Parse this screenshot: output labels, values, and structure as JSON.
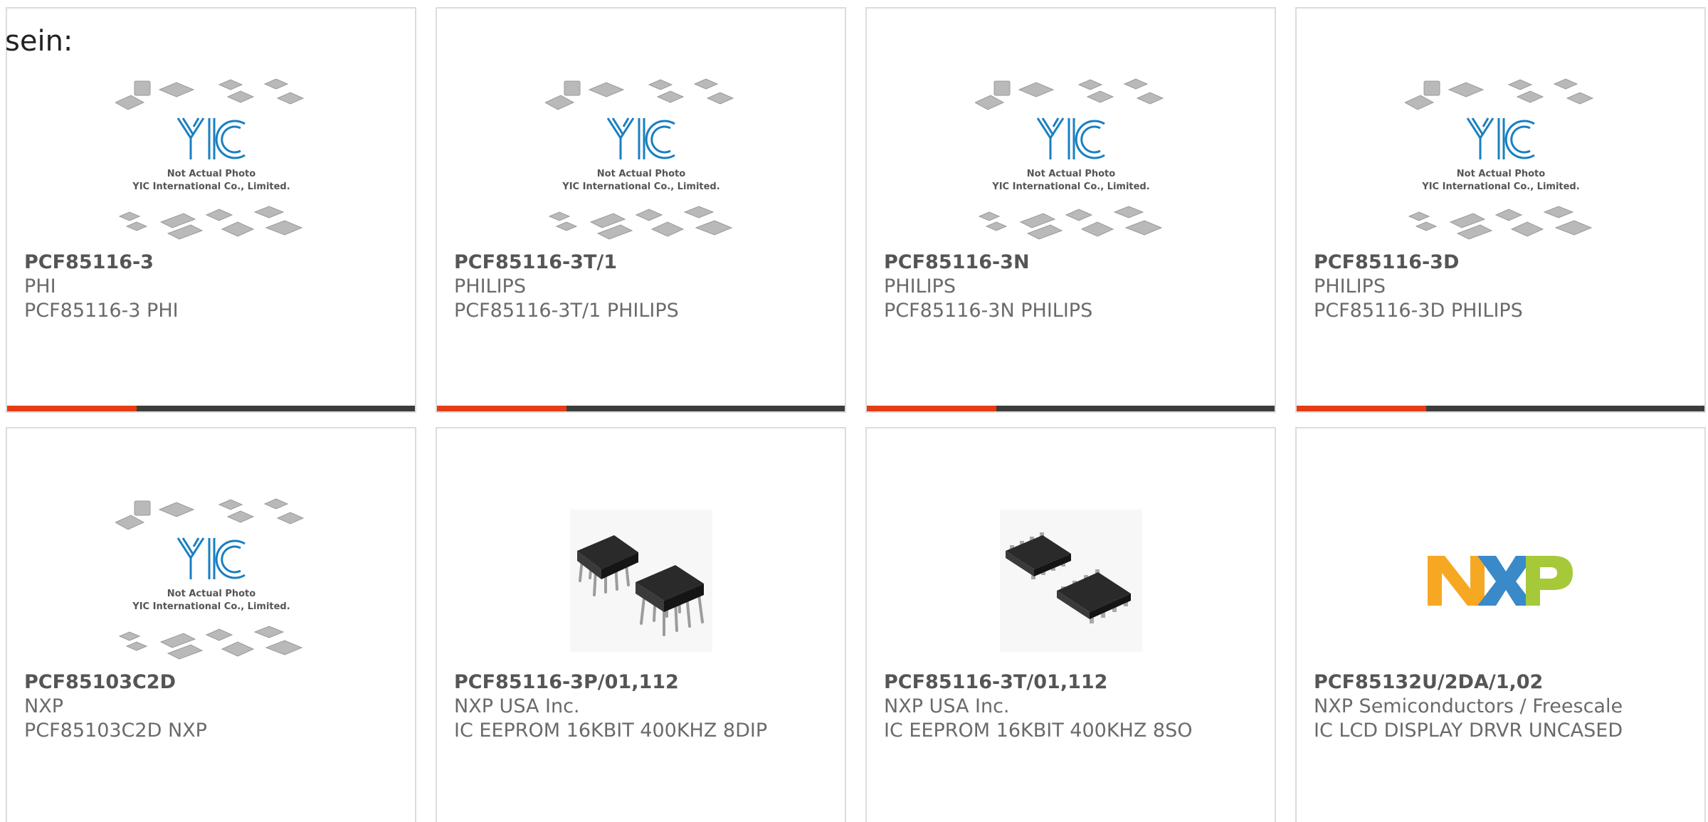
{
  "lead_text": "sein:",
  "placeholder_caption": {
    "line1": "Not Actual Photo",
    "line2": "YIC International Co., Limited."
  },
  "placeholder_logo_text": "YIC",
  "nxp_logo_text": "NXP",
  "colors": {
    "accent": "#e63c14",
    "bar_dark": "#3c3c3c",
    "card_border": "#dcdcdc",
    "text_gray": "#6a6a6a",
    "yic_blue": "#1a7fc1",
    "nxp_orange": "#f7a823",
    "nxp_blue": "#3a89c9",
    "nxp_green": "#a6c93a"
  },
  "products": [
    {
      "part": "PCF85116-3",
      "maker": "PHI",
      "desc": "PCF85116-3 PHI",
      "image": "placeholder-icon",
      "accent_bar": true
    },
    {
      "part": "PCF85116-3T/1",
      "maker": "PHILIPS",
      "desc": "PCF85116-3T/1 PHILIPS",
      "image": "placeholder-icon",
      "accent_bar": true
    },
    {
      "part": "PCF85116-3N",
      "maker": "PHILIPS",
      "desc": "PCF85116-3N PHILIPS",
      "image": "placeholder-icon",
      "accent_bar": true
    },
    {
      "part": "PCF85116-3D",
      "maker": "PHILIPS",
      "desc": "PCF85116-3D PHILIPS",
      "image": "placeholder-icon",
      "accent_bar": true
    },
    {
      "part": "PCF85103C2D",
      "maker": "NXP",
      "desc": "PCF85103C2D NXP",
      "image": "placeholder-icon",
      "accent_bar": false
    },
    {
      "part": "PCF85116-3P/01,112",
      "maker": "NXP USA Inc.",
      "desc": "IC EEPROM 16KBIT 400KHZ 8DIP",
      "image": "dip-chip-icon",
      "accent_bar": false
    },
    {
      "part": "PCF85116-3T/01,112",
      "maker": "NXP USA Inc.",
      "desc": "IC EEPROM 16KBIT 400KHZ 8SO",
      "image": "soic-chip-icon",
      "accent_bar": false
    },
    {
      "part": "PCF85132U/2DA/1,02",
      "maker": "NXP Semiconductors / Freescale",
      "desc": "IC LCD DISPLAY DRVR UNCASED",
      "image": "nxp-logo-icon",
      "accent_bar": false
    }
  ]
}
